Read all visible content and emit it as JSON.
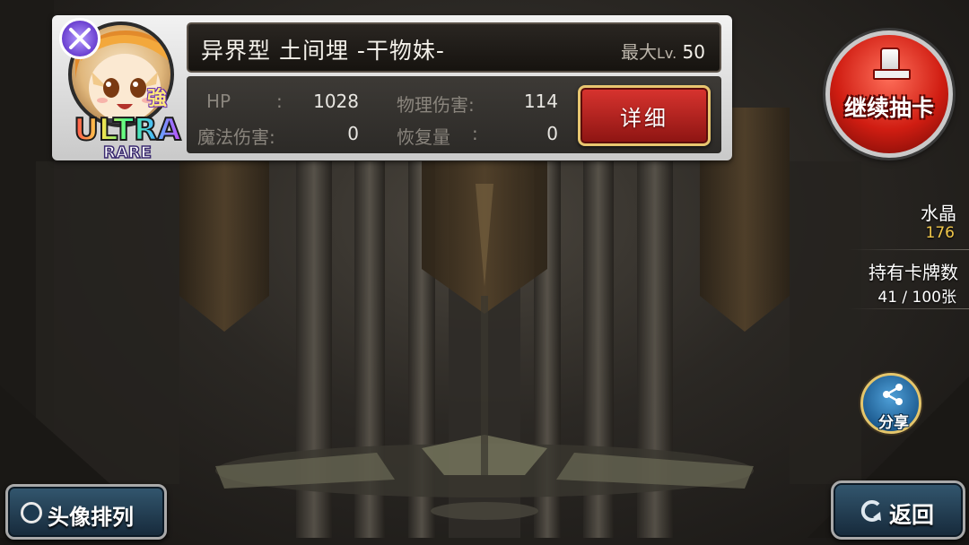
{
  "card": {
    "name": "异界型 土间埋 -干物妹-",
    "max_level_prefix": "最大",
    "max_level_lv": "Lv.",
    "max_level_value": "50",
    "strong_mark": "強",
    "rarity_line1": "ULTRA",
    "rarity_line2": "RARE",
    "type_icon": "crossed-swords-icon",
    "stats": {
      "hp_label": "HP",
      "hp_colon": ":",
      "hp_value": "1028",
      "phys_label": "物理伤害:",
      "phys_value": "114",
      "magic_label": "魔法伤害:",
      "magic_value": "0",
      "heal_label": "恢复量",
      "heal_colon": ":",
      "heal_value": "0"
    },
    "detail_button": "详细"
  },
  "hud": {
    "gacha_button": "继续抽卡",
    "crystal_label": "水晶",
    "crystal_value": "176",
    "cards_label": "持有卡牌数",
    "cards_value": "41 / 100张",
    "share_button": "分享"
  },
  "bottom": {
    "avatar_sort_button": "头像排列",
    "back_button": "返回"
  },
  "colors": {
    "detail_red": "#c0221d",
    "crystal_gold": "#f2c84a",
    "button_blue": "#274559",
    "panel_bg": "#2c2a27"
  }
}
